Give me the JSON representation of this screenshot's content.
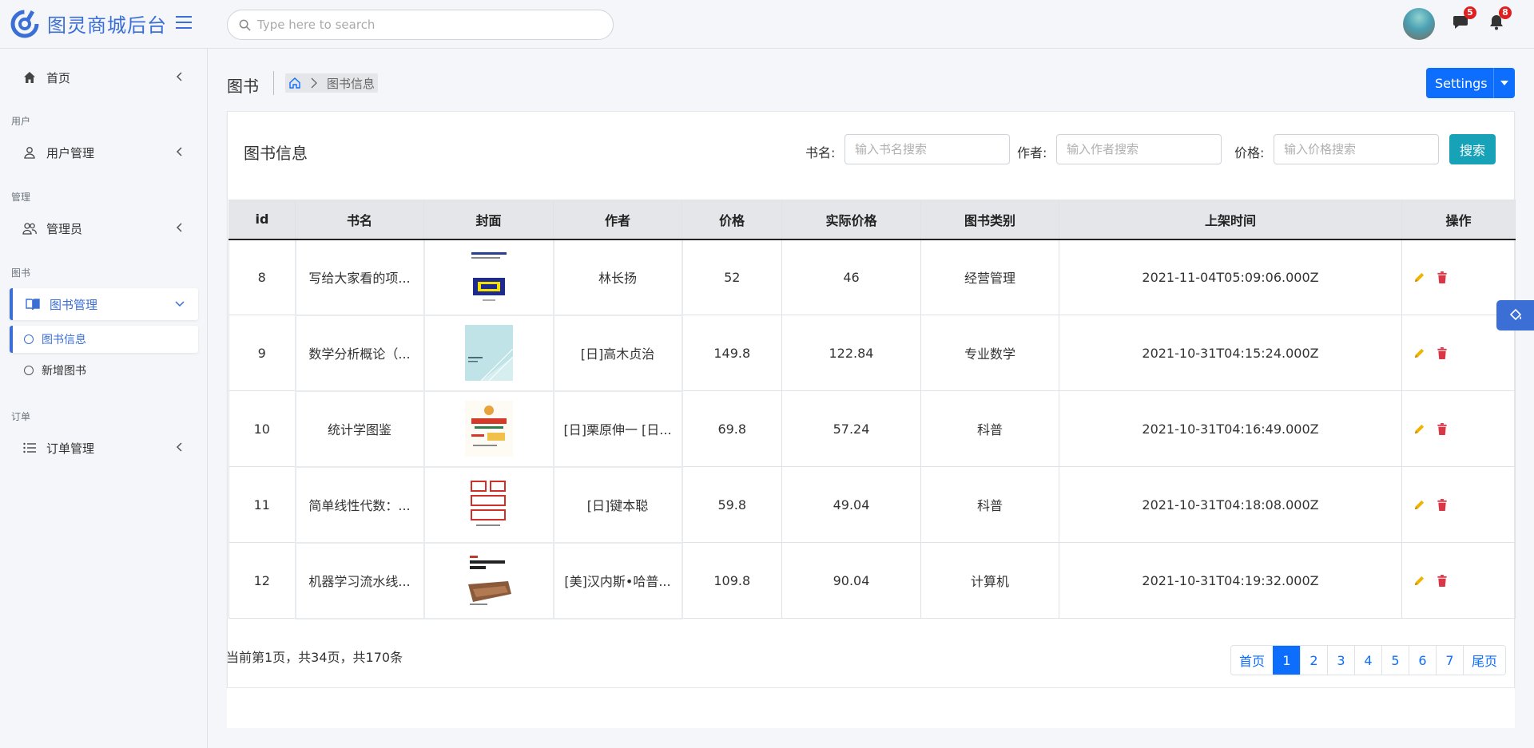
{
  "brand": {
    "title": "图灵商城后台",
    "logo_icon": "brand-logo-icon"
  },
  "search": {
    "placeholder": "Type here to search"
  },
  "header": {
    "messages_badge": "5",
    "notifications_badge": "8"
  },
  "sidebar": {
    "home": "首页",
    "section_user": "用户",
    "user_manage": "用户管理",
    "section_admin": "管理",
    "admins": "管理员",
    "section_book": "图书",
    "book_manage": "图书管理",
    "book_info": "图书信息",
    "book_add": "新增图书",
    "section_order": "订单",
    "order_manage": "订单管理"
  },
  "page": {
    "title": "图书",
    "breadcrumb_current": "图书信息",
    "settings_label": "Settings"
  },
  "card": {
    "title": "图书信息",
    "filters": {
      "name_label": "书名:",
      "name_placeholder": "输入书名搜索",
      "author_label": "作者:",
      "author_placeholder": "输入作者搜索",
      "price_label": "价格:",
      "price_placeholder": "输入价格搜索",
      "search_label": "搜索"
    }
  },
  "table": {
    "columns": [
      "id",
      "书名",
      "封面",
      "作者",
      "价格",
      "实际价格",
      "图书类别",
      "上架时间",
      "操作"
    ],
    "rows": [
      {
        "id": "8",
        "name": "写给大家看的项...",
        "author": "林长扬",
        "price": "52",
        "actual": "46",
        "category": "经营管理",
        "time": "2021-11-04T05:09:06.000Z"
      },
      {
        "id": "9",
        "name": "数学分析概论（...",
        "author": "[日]高木贞治",
        "price": "149.8",
        "actual": "122.84",
        "category": "专业数学",
        "time": "2021-10-31T04:15:24.000Z"
      },
      {
        "id": "10",
        "name": "统计学图鉴",
        "author": "[日]栗原伸一 [日...",
        "price": "69.8",
        "actual": "57.24",
        "category": "科普",
        "time": "2021-10-31T04:16:49.000Z"
      },
      {
        "id": "11",
        "name": "简单线性代数：...",
        "author": "[日]键本聪",
        "price": "59.8",
        "actual": "49.04",
        "category": "科普",
        "time": "2021-10-31T04:18:08.000Z"
      },
      {
        "id": "12",
        "name": "机器学习流水线...",
        "author": "[美]汉内斯•哈普...",
        "price": "109.8",
        "actual": "90.04",
        "category": "计算机",
        "time": "2021-10-31T04:19:32.000Z"
      }
    ]
  },
  "pagination": {
    "info": "当前第1页，共34页，共170条",
    "first": "首页",
    "pages": [
      "1",
      "2",
      "3",
      "4",
      "5",
      "6",
      "7"
    ],
    "last": "尾页",
    "current": "1"
  },
  "colors": {
    "brand": "#3b6fd6",
    "primary": "#0d6efd",
    "info": "#17a2b8",
    "edit": "#f0b400",
    "delete": "#dc3545",
    "badge": "#e02020"
  }
}
